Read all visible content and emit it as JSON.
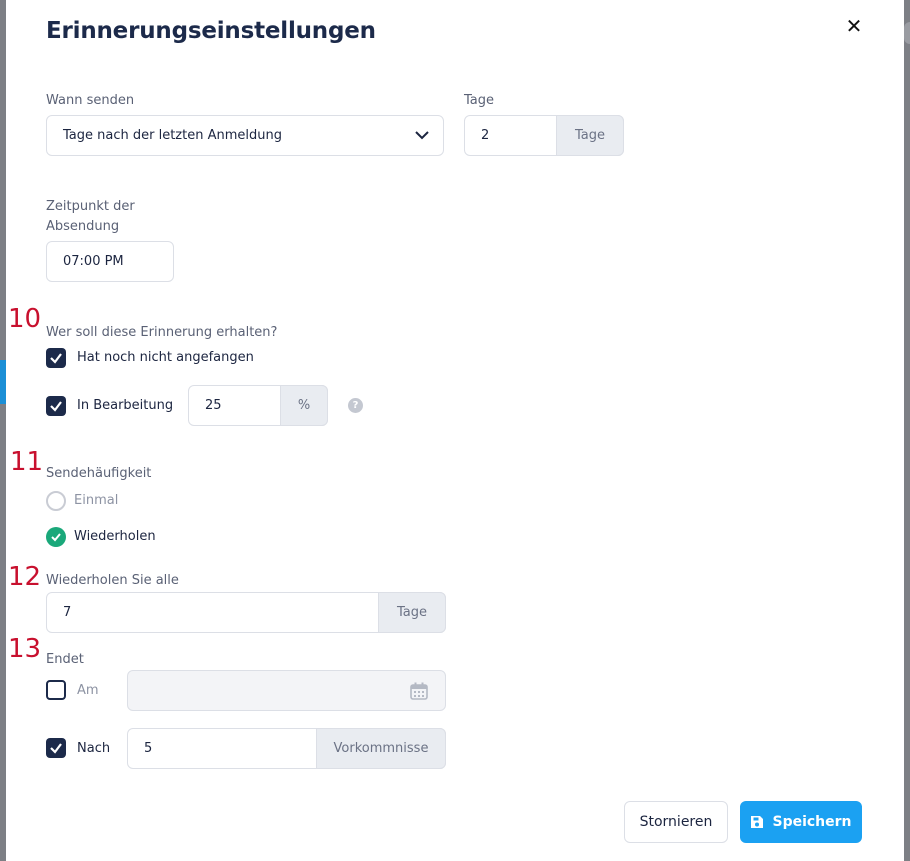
{
  "dialog": {
    "title": "Erinnerungseinstellungen",
    "close_glyph": "✕"
  },
  "when_send": {
    "label": "Wann senden",
    "selected": "Tage nach der letzten Anmeldung"
  },
  "days": {
    "label": "Tage",
    "value": "2",
    "unit": "Tage"
  },
  "send_time": {
    "label_line1": "Zeitpunkt der",
    "label_line2": "Absendung",
    "value": "07:00 PM"
  },
  "recipients": {
    "label": "Wer soll diese Erinnerung erhalten?",
    "not_started": {
      "label": "Hat noch nicht angefangen",
      "checked": true
    },
    "in_progress": {
      "label": "In Bearbeitung",
      "checked": true,
      "value": "25",
      "unit": "%"
    },
    "help_glyph": "?"
  },
  "frequency": {
    "label": "Sendehäufigkeit",
    "once": {
      "label": "Einmal",
      "selected": false
    },
    "repeat": {
      "label": "Wiederholen",
      "selected": true
    }
  },
  "repeat_every": {
    "label": "Wiederholen Sie alle",
    "value": "7",
    "unit": "Tage"
  },
  "ends": {
    "label": "Endet",
    "on": {
      "label": "Am",
      "checked": false,
      "value": ""
    },
    "after": {
      "label": "Nach",
      "checked": true,
      "value": "5",
      "unit": "Vorkommnisse"
    }
  },
  "markers": [
    "10",
    "11",
    "12",
    "13"
  ],
  "footer": {
    "cancel_label": "Stornieren",
    "save_label": "Speichern"
  },
  "colors": {
    "primary_dark": "#1c2a4a",
    "accent_blue": "#1ba1f2",
    "success_green": "#1aa87a",
    "marker_red": "#c8102e"
  }
}
